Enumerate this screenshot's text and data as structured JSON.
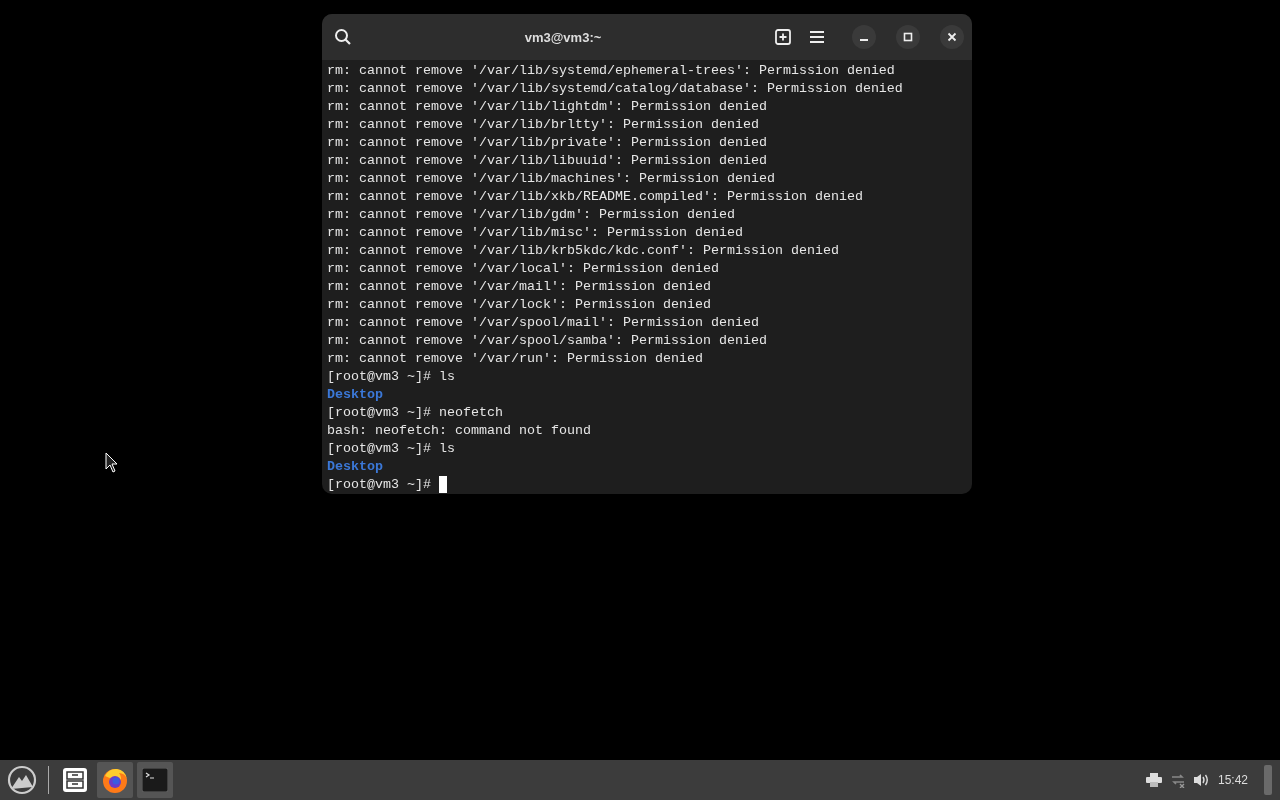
{
  "window": {
    "title": "vm3@vm3:~"
  },
  "terminal": {
    "lines": [
      {
        "kind": "output",
        "text": "rm: cannot remove '/var/lib/systemd/ephemeral-trees': Permission denied"
      },
      {
        "kind": "output",
        "text": "rm: cannot remove '/var/lib/systemd/catalog/database': Permission denied"
      },
      {
        "kind": "output",
        "text": "rm: cannot remove '/var/lib/lightdm': Permission denied"
      },
      {
        "kind": "output",
        "text": "rm: cannot remove '/var/lib/brltty': Permission denied"
      },
      {
        "kind": "output",
        "text": "rm: cannot remove '/var/lib/private': Permission denied"
      },
      {
        "kind": "output",
        "text": "rm: cannot remove '/var/lib/libuuid': Permission denied"
      },
      {
        "kind": "output",
        "text": "rm: cannot remove '/var/lib/machines': Permission denied"
      },
      {
        "kind": "output",
        "text": "rm: cannot remove '/var/lib/xkb/README.compiled': Permission denied"
      },
      {
        "kind": "output",
        "text": "rm: cannot remove '/var/lib/gdm': Permission denied"
      },
      {
        "kind": "output",
        "text": "rm: cannot remove '/var/lib/misc': Permission denied"
      },
      {
        "kind": "output",
        "text": "rm: cannot remove '/var/lib/krb5kdc/kdc.conf': Permission denied"
      },
      {
        "kind": "output",
        "text": "rm: cannot remove '/var/local': Permission denied"
      },
      {
        "kind": "output",
        "text": "rm: cannot remove '/var/mail': Permission denied"
      },
      {
        "kind": "output",
        "text": "rm: cannot remove '/var/lock': Permission denied"
      },
      {
        "kind": "output",
        "text": "rm: cannot remove '/var/spool/mail': Permission denied"
      },
      {
        "kind": "output",
        "text": "rm: cannot remove '/var/spool/samba': Permission denied"
      },
      {
        "kind": "output",
        "text": "rm: cannot remove '/var/run': Permission denied"
      },
      {
        "kind": "prompt",
        "text": "[root@vm3 ~]# ls"
      },
      {
        "kind": "directory",
        "text": "Desktop"
      },
      {
        "kind": "prompt",
        "text": "[root@vm3 ~]# neofetch"
      },
      {
        "kind": "output",
        "text": "bash: neofetch: command not found"
      },
      {
        "kind": "prompt",
        "text": "[root@vm3 ~]# ls"
      },
      {
        "kind": "directory",
        "text": "Desktop"
      },
      {
        "kind": "prompt",
        "text": "[root@vm3 ~]#",
        "cursor": true
      }
    ]
  },
  "taskbar": {
    "apps": [
      {
        "kind": "files",
        "active": false
      },
      {
        "kind": "browser",
        "active": true
      },
      {
        "kind": "terminal",
        "active": true
      }
    ],
    "clock": "15:42"
  }
}
